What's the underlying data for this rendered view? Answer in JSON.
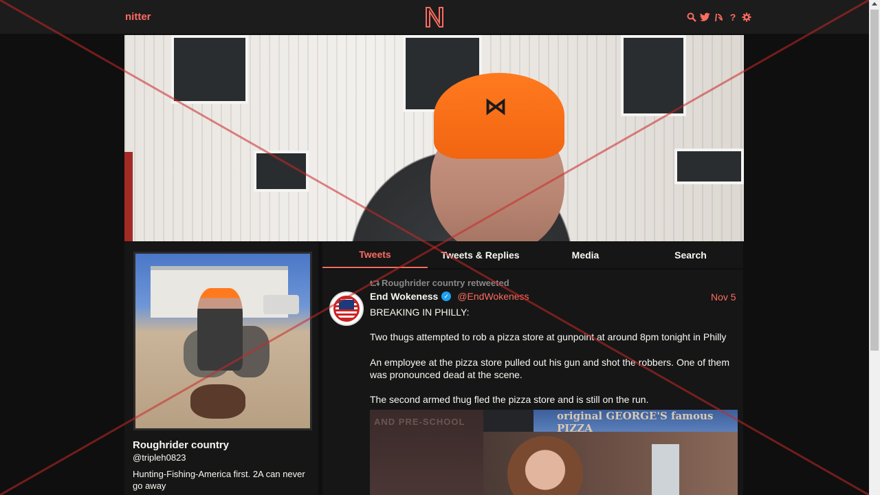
{
  "navbar": {
    "brand": "nitter",
    "icons": [
      "search-icon",
      "twitter-bird-icon",
      "rss-icon",
      "help-icon",
      "gear-icon"
    ]
  },
  "profile": {
    "fullname": "Roughrider country",
    "username": "@tripleh0823",
    "bio": "Hunting-Fishing-America first. 2A can never go away"
  },
  "tabs": [
    {
      "label": "Tweets",
      "active": true
    },
    {
      "label": "Tweets & Replies",
      "active": false
    },
    {
      "label": "Media",
      "active": false
    },
    {
      "label": "Search",
      "active": false
    }
  ],
  "tweet": {
    "retweet_header": "Roughrider country retweeted",
    "fullname": "End Wokeness",
    "handle": "@EndWokeness",
    "date": "Nov 5",
    "text": "BREAKING IN PHILLY:\n\nTwo thugs attempted to rob a pizza store at gunpoint at around 8pm tonight in Philly\n\nAn employee at the pizza store pulled out his gun and shot the robbers. One of them was pronounced dead at the scene.\n\nThe second armed thug fled the pizza store and is still on the run.",
    "media": {
      "left_sign": "AND PRE-SCHOOL",
      "store_sign": "original GEORGE'S famous PIZZA"
    }
  },
  "colors": {
    "accent": "#ff6c60",
    "background": "#0f0f0f",
    "panel": "#161616",
    "text": "#f8f8f2"
  }
}
